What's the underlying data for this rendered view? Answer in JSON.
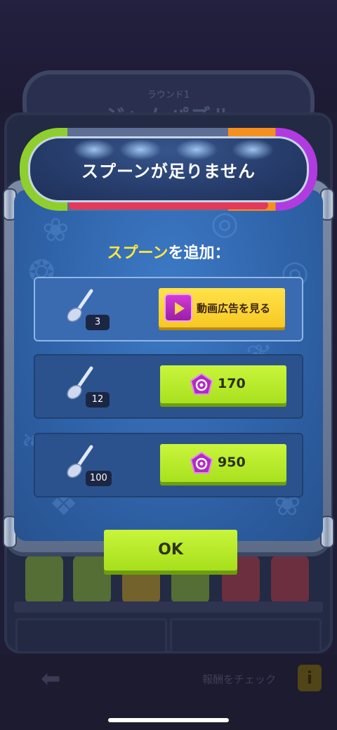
{
  "background": {
    "round_label": "ラウンド1",
    "round_title": "ジャムパズル",
    "reward_check": "報酬をチェック",
    "info_icon": "i"
  },
  "dialog": {
    "title": "スプーンが足りません",
    "heading_highlight": "スプーン",
    "heading_rest": "を追加：",
    "offers": [
      {
        "count": "3",
        "action": "動画広告を見る",
        "icon": "video-ad-icon"
      },
      {
        "count": "12",
        "price": "170",
        "icon": "gem-icon"
      },
      {
        "count": "100",
        "price": "950",
        "icon": "gem-icon"
      }
    ],
    "ok_label": "OK"
  },
  "colors": {
    "accent_yellow": "#ffe83d",
    "button_green": "#b6e826",
    "ad_button_yellow": "#f9d134",
    "gem_purple": "#b22ac4"
  }
}
